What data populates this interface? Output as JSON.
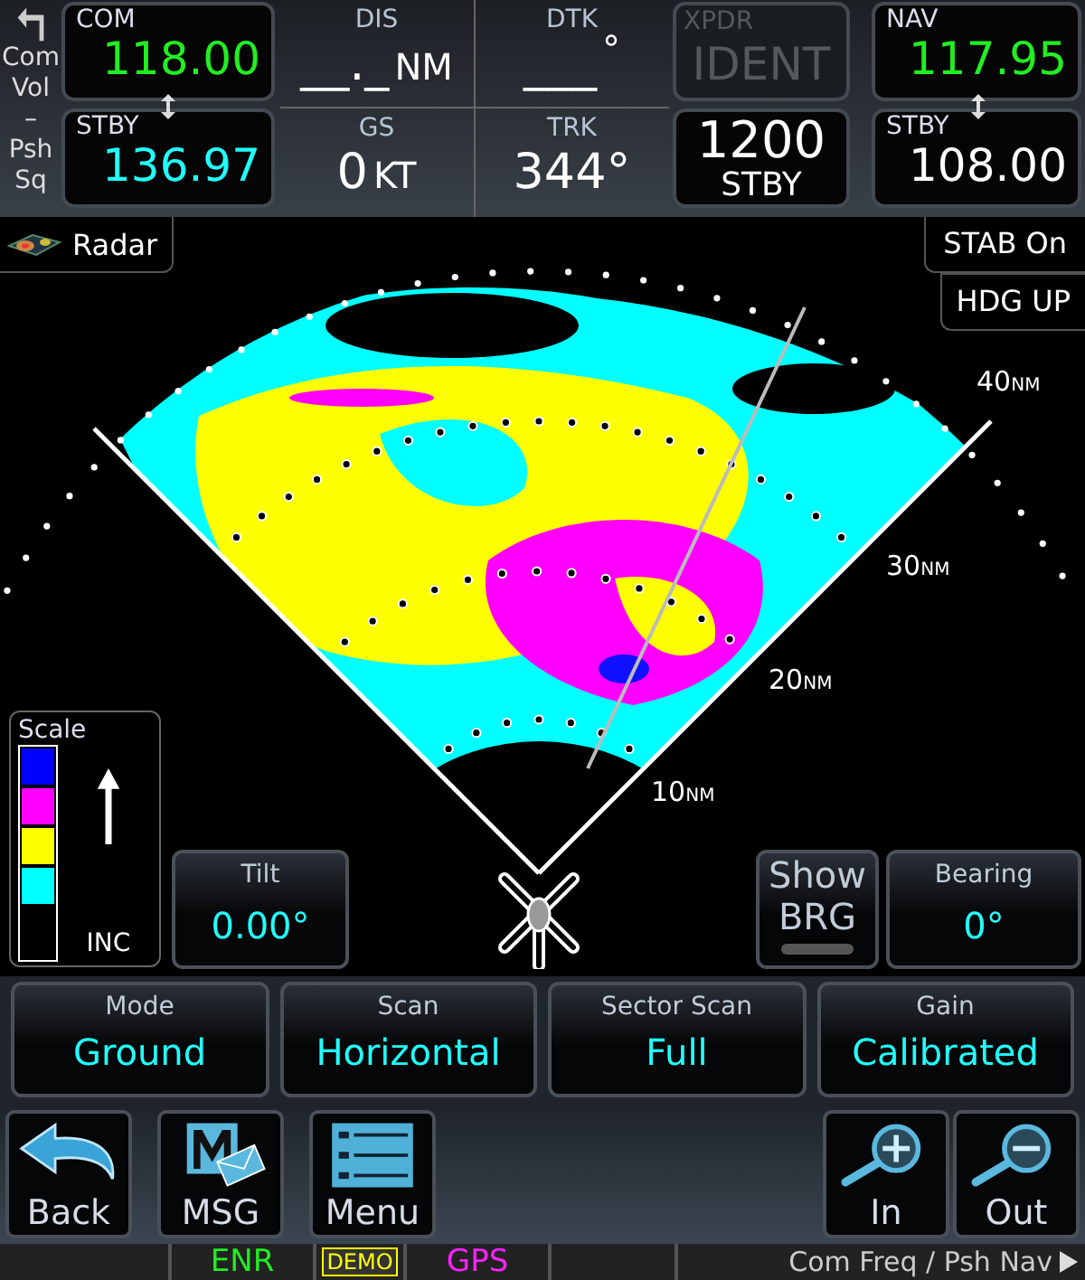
{
  "side_strip": {
    "lines": [
      "Com",
      "Vol",
      "–",
      "Psh",
      "Sq"
    ]
  },
  "com": {
    "label": "COM",
    "active": "118.00",
    "standby_label": "STBY",
    "standby": "136.97"
  },
  "data_fields": [
    {
      "label": "DIS",
      "value": "__._",
      "unit": "NM"
    },
    {
      "label": "DTK",
      "value": "___",
      "unit": "°"
    },
    {
      "label": "GS",
      "value": "0",
      "unit": "KT"
    },
    {
      "label": "TRK",
      "value": "344°"
    }
  ],
  "xpdr": {
    "label": "XPDR",
    "ident": "IDENT",
    "disabled": true,
    "code": "1200",
    "mode": "STBY"
  },
  "nav": {
    "label": "NAV",
    "active": "117.95",
    "standby_label": "STBY",
    "standby": "108.00"
  },
  "radar": {
    "title": "Radar",
    "stab": "STAB On",
    "orientation": "HDG UP",
    "ranges": [
      {
        "value": "40",
        "unit": "NM"
      },
      {
        "value": "30",
        "unit": "NM"
      },
      {
        "value": "20",
        "unit": "NM"
      },
      {
        "value": "10",
        "unit": "NM"
      }
    ]
  },
  "scale": {
    "title": "Scale",
    "label": "INC",
    "levels": [
      {
        "color": "#0000ff"
      },
      {
        "color": "#ff00ff"
      },
      {
        "color": "#ffff00"
      },
      {
        "color": "#00ffff"
      }
    ]
  },
  "tilt": {
    "label": "Tilt",
    "value": "0.00°"
  },
  "show_brg": {
    "label": "Show BRG",
    "on": false
  },
  "bearing": {
    "label": "Bearing",
    "value": "0°"
  },
  "settings": [
    {
      "label": "Mode",
      "value": "Ground"
    },
    {
      "label": "Scan",
      "value": "Horizontal"
    },
    {
      "label": "Sector Scan",
      "value": "Full"
    },
    {
      "label": "Gain",
      "value": "Calibrated"
    }
  ],
  "nav_buttons": [
    {
      "kind": "back",
      "label": "Back"
    },
    {
      "kind": "msg",
      "label": "MSG"
    },
    {
      "kind": "menu",
      "label": "Menu"
    }
  ],
  "zoom_buttons": [
    {
      "kind": "in",
      "label": "In"
    },
    {
      "kind": "out",
      "label": "Out"
    }
  ],
  "status_bar": {
    "items": [
      {
        "text": "ENR",
        "color": "#22ee22",
        "boxed": false
      },
      {
        "text": "DEMO",
        "color": "#ffff00",
        "boxed": true
      },
      {
        "text": "GPS",
        "color": "#ff22ff",
        "boxed": false
      }
    ],
    "hint": "Com Freq / Psh Nav"
  }
}
